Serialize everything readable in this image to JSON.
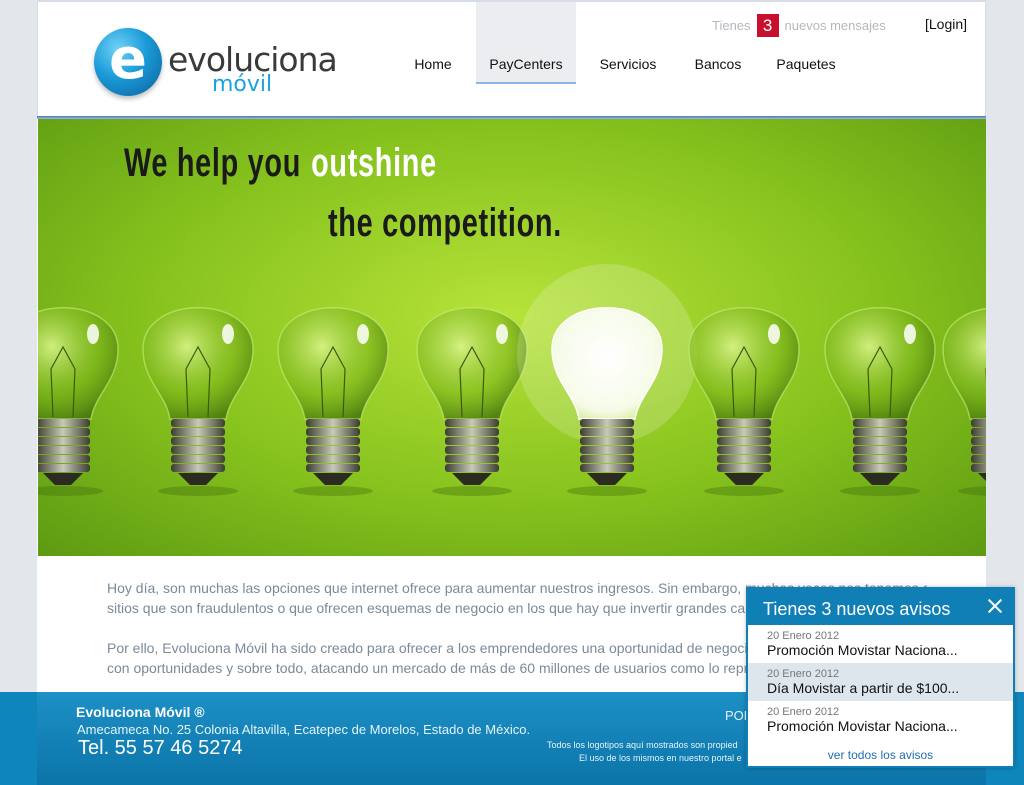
{
  "logo": {
    "mark": "e",
    "name": "evoluciona",
    "sub": "móvil"
  },
  "header": {
    "msg_prefix": "Tienes",
    "msg_count": "3",
    "msg_suffix": "nuevos mensajes",
    "login": "[Login]"
  },
  "nav": {
    "items": [
      {
        "label": "Home"
      },
      {
        "label": "PayCenters",
        "active": true
      },
      {
        "label": "Servicios"
      },
      {
        "label": "Bancos"
      },
      {
        "label": "Paquetes"
      }
    ]
  },
  "hero": {
    "line1_a": "We help you",
    "line1_b": "outshine",
    "line2": "the competition.",
    "bulbs_total": 7,
    "lit_bulb_index": 4
  },
  "copy": {
    "p1_l1": "Hoy día, son muchas las opciones que internet ofrece para aumentar nuestros ingresos. Sin embargo, muchas veces nos topamos con",
    "p1_l2": "sitios que son fraudulentos o que ofrecen esquemas de negocio en los que hay que invertir grandes cantidades",
    "p2_l1": "Por ello, Evoluciona Móvil ha sido creado para ofrecer a los emprendedores una oportunidad de negocio rentable",
    "p2_l2": "con oportunidades y sobre todo, atacando un mercado de más de 60 millones de usuarios como lo representa"
  },
  "footer": {
    "name": "Evoluciona Móvil ®",
    "address": "Amecameca No. 25 Colonia Altavilla, Ecatepec de Morelos, Estado de México.",
    "tel": "Tel. 55 57 46 5274",
    "right": "POL",
    "legal1": "Todos los logotipos aquí mostrados son propied",
    "legal2": "El uso de los mismos en nuestro portal e"
  },
  "notifications": {
    "title": "Tienes 3 nuevos avisos",
    "items": [
      {
        "date": "20 Enero 2012",
        "text": "Promoción Movistar Naciona..."
      },
      {
        "date": "20 Enero 2012",
        "text": "Día Movistar a partir de $100..."
      },
      {
        "date": "20 Enero 2012",
        "text": "Promoción Movistar Naciona..."
      }
    ],
    "all_link": "ver todos los avisos"
  },
  "colors": {
    "accent": "#0f7fb6",
    "badge": "#c8102e",
    "hero_green": "#86c21d"
  }
}
